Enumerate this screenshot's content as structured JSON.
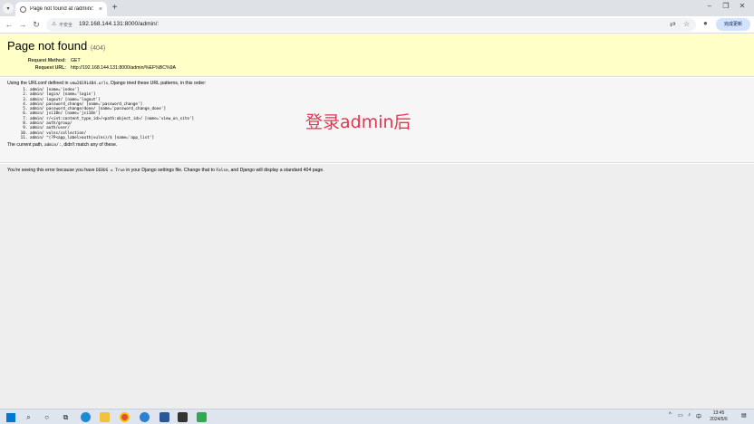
{
  "browser": {
    "tab_title": "Page not found at /admin/:",
    "address_security": "不安全",
    "address_url": "192.168.144.131:8000/admin/:",
    "update_label": "完成更新"
  },
  "page": {
    "title": "Page not found",
    "status_code": "(404)",
    "request_method_label": "Request Method:",
    "request_method": "GET",
    "request_url_label": "Request URL:",
    "request_url": "http://192.168.144.131:8000/admin/%EF%BC%9A",
    "urlconf_prefix": "Using the URLconf defined in",
    "urlconf_module": "vmw2019L404.urls",
    "urlconf_suffix": ", Django tried these URL patterns, in this order:",
    "patterns": [
      "admin/ [name='index']",
      "admin/ login/ [name='login']",
      "admin/ logout/ [name='logout']",
      "admin/ password_change/ [name='password_change']",
      "admin/ password_change/done/ [name='password_change_done']",
      "admin/ jsi18n/ [name='jsi18n']",
      "admin/ r/<int:content_type_id>/<path:object_id>/ [name='view_on_site']",
      "admin/ auth/group/",
      "admin/ auth/user/",
      "admin/ vulns/collection/",
      "admin/ ^(?P<app_label>auth|vulns)/$ [name='app_list']"
    ],
    "path_prefix": "The current path,",
    "path_value": "admin/:",
    "path_suffix": ", didn't match any of these.",
    "debug_prefix": "You're seeing this error because you have",
    "debug_setting": "DEBUG = True",
    "debug_middle": "in your Django settings file. Change that to",
    "debug_false": "False",
    "debug_suffix": ", and Django will display a standard 404 page."
  },
  "annotation": "登录admin后",
  "taskbar": {
    "time": "13:45",
    "date": "2024/5/6"
  },
  "colors": {
    "summary_bg": "#ffffc8",
    "annotation": "#e8344e",
    "accent": "#0078d4"
  }
}
